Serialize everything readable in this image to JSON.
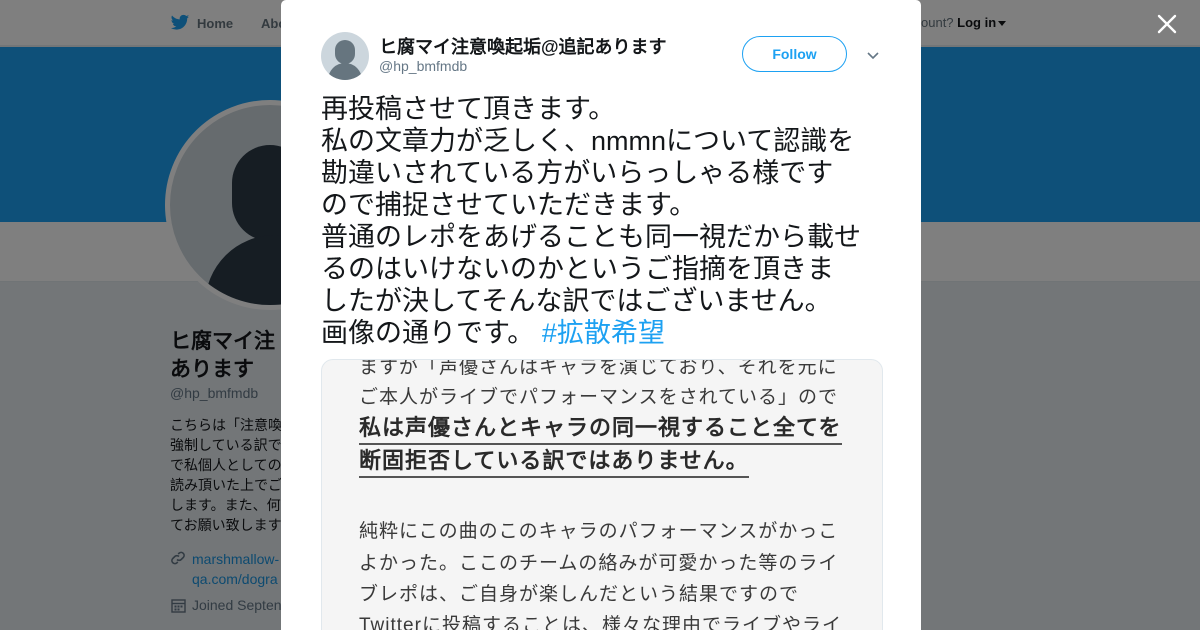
{
  "nav": {
    "home": "Home",
    "about": "Abo",
    "account_prompt": "ount?",
    "login": "Log in"
  },
  "background_profile": {
    "name_line1": "ヒ腐マイ注",
    "name_line2": "あります",
    "handle": "@hp_bmfmdb",
    "bio_lines": [
      "こちらは「注意喚",
      "強制している訳で",
      "で私個人としての",
      "読み頂いた上でご",
      "します。また、何",
      "てお願い致します"
    ],
    "link_line1": "marshmallow-",
    "link_line2": "qa.com/dogra",
    "joined": "Joined Septen"
  },
  "tweet": {
    "author_name": "ヒ腐マイ注意喚起垢@追記あります",
    "author_handle": "@hp_bmfmdb",
    "follow_label": "Follow",
    "text_lines": [
      "再投稿させて頂きます。",
      "私の文章力が乏しく、nmmnについて認識を",
      "勘違いされている方がいらっしゃる様です",
      "ので捕捉させていただきます。",
      "普通のレポをあげることも同一視だから載せ",
      "るのはいけないのかというご指摘を頂きま",
      "したが決してそんな訳ではございません。"
    ],
    "last_line": "画像の通りです。 ",
    "hashtag": "#拡散希望",
    "image_lines": [
      "ますが「声優さんはキャラを演じており、それを元に",
      "ご本人がライブでパフォーマンスをされている」ので",
      "私は声優さんとキャラの同一視すること全てを",
      "断固拒否している訳ではありません。",
      "純粋にこの曲のこのキャラのパフォーマンスがかっこ",
      "よかった。ここのチームの絡みが可愛かった等のライ",
      "ブレポは、ご自身が楽しんだという結果ですので",
      "Twitterに投稿することは、様々な理由でライブやライ"
    ]
  },
  "colors": {
    "accent": "#1da1f2",
    "banner": "#1da1f2",
    "overlay": "rgba(0,0,0,0.5)"
  },
  "icons": {
    "nav_logo": "twitter-bird-icon",
    "close": "close-icon",
    "menu": "chevron-down-icon",
    "link": "link-icon",
    "calendar": "calendar-icon"
  }
}
